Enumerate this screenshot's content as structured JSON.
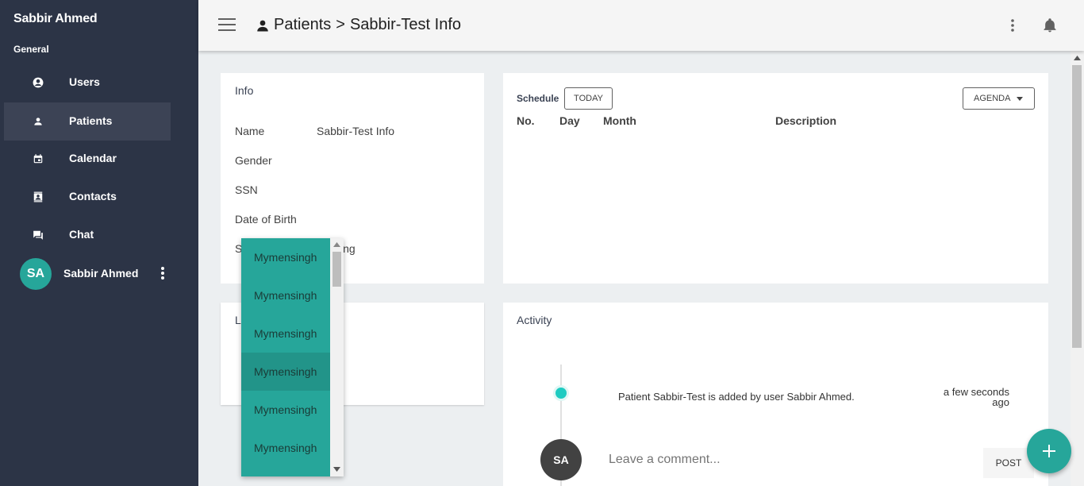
{
  "sidebar": {
    "title": "Sabbir Ahmed",
    "section": "General",
    "items": [
      {
        "label": "Users",
        "icon": "account-circle-icon"
      },
      {
        "label": "Patients",
        "icon": "person-icon"
      },
      {
        "label": "Calendar",
        "icon": "calendar-icon"
      },
      {
        "label": "Contacts",
        "icon": "contacts-icon"
      },
      {
        "label": "Chat",
        "icon": "chat-icon"
      }
    ],
    "active_item": "Patients",
    "user": {
      "initials": "SA",
      "name": "Sabbir Ahmed"
    }
  },
  "header": {
    "crumb_root": "Patients",
    "crumb_sep": ">",
    "crumb_current": "Sabbir-Test Info"
  },
  "info": {
    "title": "Info",
    "rows": [
      {
        "label": "Name",
        "value": "Sabbir-Test Info"
      },
      {
        "label": "Gender",
        "value": ""
      },
      {
        "label": "SSN",
        "value": ""
      },
      {
        "label": "Date of Birth",
        "value": ""
      },
      {
        "label": "S",
        "value": "ing"
      }
    ]
  },
  "l_card": {
    "title": "L"
  },
  "schedule": {
    "title": "Schedule",
    "today_label": "TODAY",
    "view_label": "AGENDA",
    "columns": [
      "No.",
      "Day",
      "Month",
      "Description"
    ]
  },
  "activity": {
    "title": "Activity",
    "entries": [
      {
        "text": "Patient Sabbir-Test is added by user Sabbir Ahmed.",
        "time": "a few seconds ago"
      }
    ],
    "comment_initials": "SA",
    "comment_placeholder": "Leave a comment...",
    "post_label": "POST"
  },
  "dropdown": {
    "options": [
      "Mymensingh",
      "Mymensingh",
      "Mymensingh",
      "Mymensingh",
      "Mymensingh",
      "Mymensingh"
    ],
    "highlighted_index": 3
  },
  "colors": {
    "sidebar_bg": "#2c3446",
    "accent": "#26a69a",
    "timeline_dot": "#1ecbc1"
  }
}
